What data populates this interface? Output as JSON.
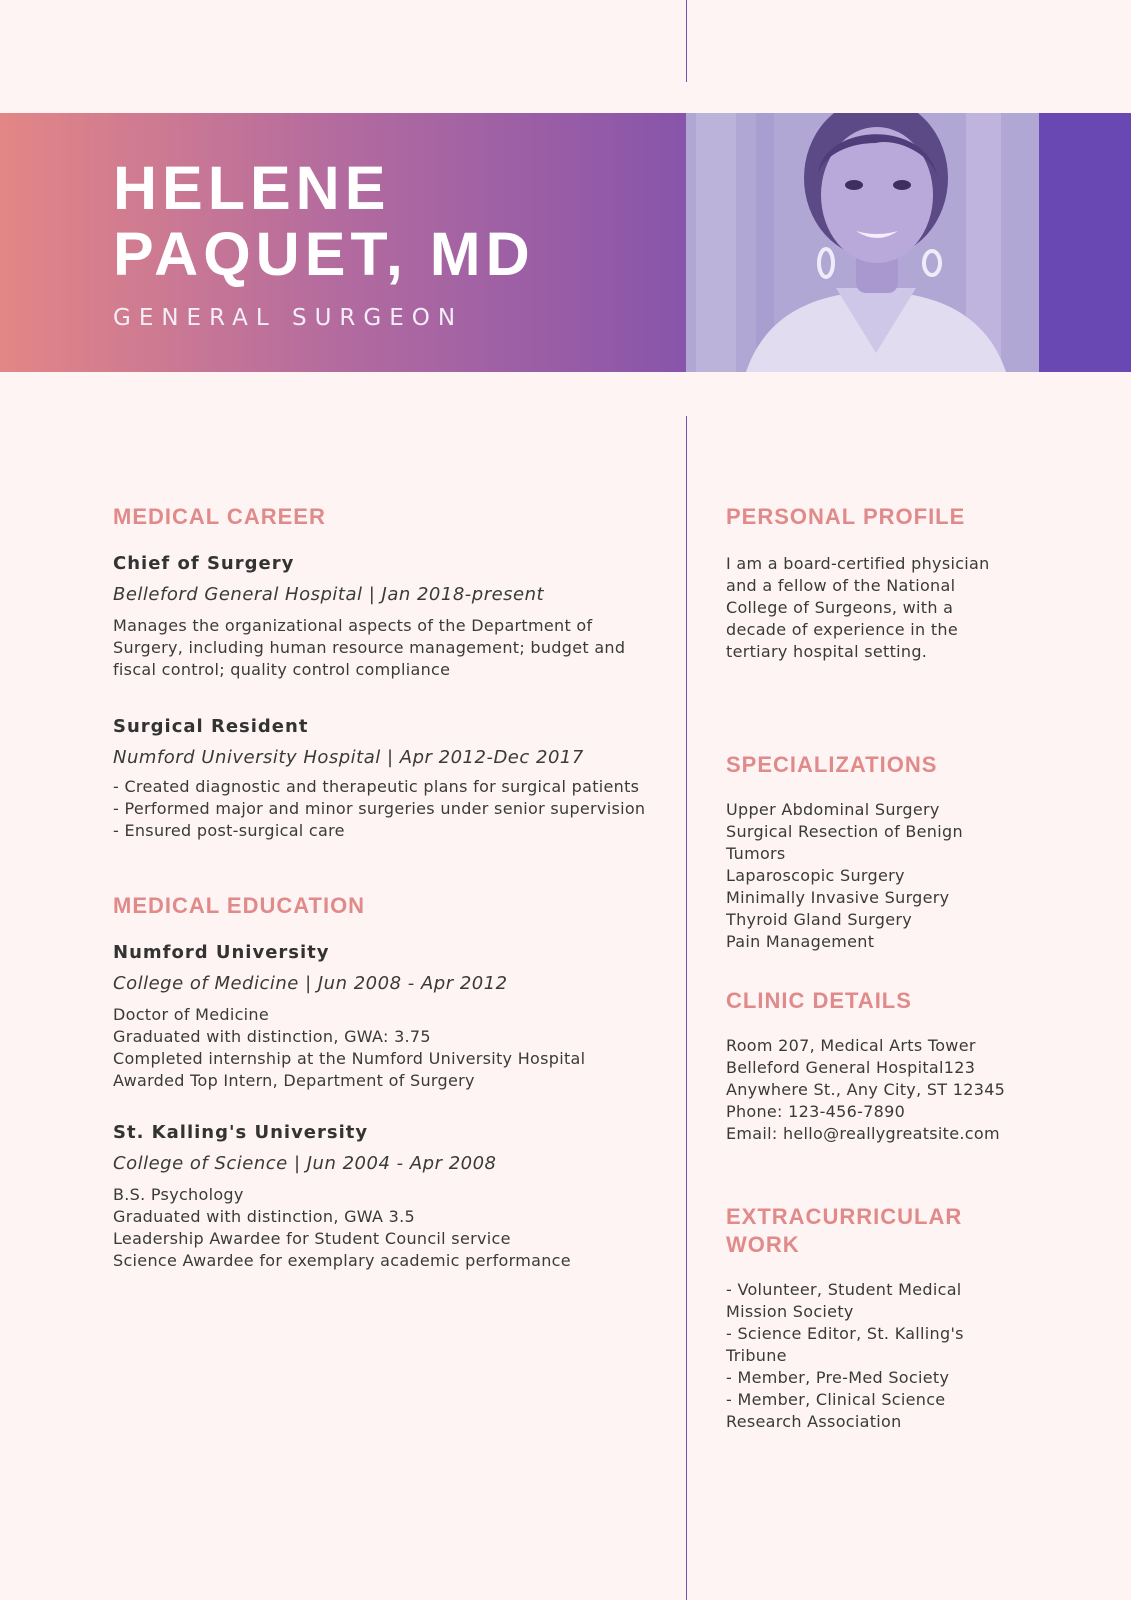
{
  "header": {
    "name_line1": "HELENE",
    "name_line2": "PAQUET, MD",
    "role": "GENERAL SURGEON"
  },
  "colors": {
    "accent": "#e08a8a",
    "purple": "#6a48b4",
    "background": "#fdf4f3"
  },
  "career": {
    "title": "MEDICAL CAREER",
    "entries": [
      {
        "title": "Chief of Surgery",
        "subtitle": "Belleford General Hospital | Jan 2018-present",
        "lines": [
          "Manages the organizational aspects of the Department of",
          "Surgery, including human resource management; budget and",
          "fiscal control; quality control compliance"
        ]
      },
      {
        "title": "Surgical Resident",
        "subtitle": "Numford University Hospital | Apr 2012-Dec 2017",
        "lines": [
          "- Created diagnostic and therapeutic plans for surgical patients",
          "- Performed major and minor surgeries under senior supervision",
          "- Ensured post-surgical care"
        ]
      }
    ]
  },
  "education": {
    "title": "MEDICAL EDUCATION",
    "entries": [
      {
        "title": "Numford University",
        "subtitle": "College of Medicine | Jun 2008 - Apr 2012",
        "lines": [
          "Doctor of Medicine",
          "Graduated with distinction, GWA: 3.75",
          "Completed internship at the Numford University Hospital",
          "Awarded Top Intern, Department of Surgery"
        ]
      },
      {
        "title": "St. Kalling's University",
        "subtitle": "College of Science | Jun 2004 - Apr 2008",
        "lines": [
          "B.S. Psychology",
          "Graduated with distinction, GWA 3.5",
          "Leadership Awardee for Student Council service",
          "Science Awardee for exemplary academic performance"
        ]
      }
    ]
  },
  "profile": {
    "title": "PERSONAL PROFILE",
    "lines": [
      "I am a board-certified physician",
      "and a fellow of the National",
      "College of Surgeons, with a",
      "decade of experience in the",
      "tertiary hospital setting."
    ]
  },
  "specializations": {
    "title": "SPECIALIZATIONS",
    "lines": [
      "Upper Abdominal Surgery",
      "Surgical Resection of Benign",
      "Tumors",
      "Laparoscopic Surgery",
      "Minimally Invasive Surgery",
      "Thyroid Gland Surgery",
      "Pain Management"
    ]
  },
  "clinic": {
    "title": "CLINIC DETAILS",
    "lines": [
      "Room 207, Medical Arts Tower",
      "Belleford General Hospital123",
      "Anywhere St., Any City, ST 12345",
      "Phone: 123-456-7890",
      "Email: hello@reallygreatsite.com"
    ]
  },
  "extracurricular": {
    "title_line1": "EXTRACURRICULAR",
    "title_line2": "WORK",
    "lines": [
      "- Volunteer, Student Medical",
      "Mission Society",
      "- Science Editor, St. Kalling's",
      "Tribune",
      "- Member, Pre-Med Society",
      "- Member, Clinical Science",
      "Research Association"
    ]
  }
}
